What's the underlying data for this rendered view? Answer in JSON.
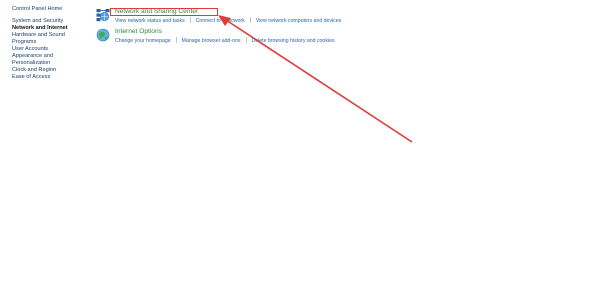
{
  "sidebar": {
    "home": "Control Panel Home",
    "items": [
      {
        "label": "System and Security",
        "active": false
      },
      {
        "label": "Network and Internet",
        "active": true
      },
      {
        "label": "Hardware and Sound",
        "active": false
      },
      {
        "label": "Programs",
        "active": false
      },
      {
        "label": "User Accounts",
        "active": false
      },
      {
        "label": "Appearance and",
        "active": false
      },
      {
        "label": "Personalization",
        "active": false
      },
      {
        "label": "Clock and Region",
        "active": false
      },
      {
        "label": "Ease of Access",
        "active": false
      }
    ]
  },
  "sections": [
    {
      "title": "Network and Sharing Center",
      "icon": "network-globe-icon",
      "links": [
        "View network status and tasks",
        "Connect to a network",
        "View network computers and devices"
      ]
    },
    {
      "title": "Internet Options",
      "icon": "internet-globe-icon",
      "links": [
        "Change your homepage",
        "Manage browser add-ons",
        "Delete browsing history and cookies"
      ]
    }
  ],
  "annotation": {
    "color": "#e03b3b"
  },
  "colors": {
    "title": "#2d8a3a",
    "link": "#2a64b0",
    "sidebar": "#1a3f6b"
  }
}
